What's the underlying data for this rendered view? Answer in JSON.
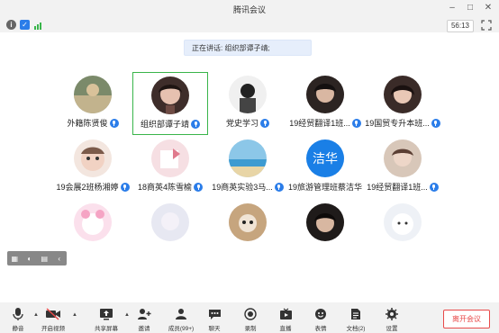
{
  "window": {
    "title": "腾讯会议"
  },
  "status": {
    "timer": "56:13"
  },
  "main": {
    "speaking": "正在讲话: 组织部谭子靖;"
  },
  "participants": [
    {
      "name": "外籍陈贤俊",
      "mic": true
    },
    {
      "name": "组织部谭子靖",
      "mic": true,
      "active": true
    },
    {
      "name": "党史学习",
      "mic": true
    },
    {
      "name": "19经贸翻译1班...",
      "mic": true
    },
    {
      "name": "19国贸专升本班...",
      "mic": true
    },
    {
      "name": "19会展2班杨湘婷",
      "mic": true
    },
    {
      "name": "18商英4陈雪榆",
      "mic": true
    },
    {
      "name": "19商英实验3马...",
      "mic": true
    },
    {
      "name": "19旅游管理班蔡洁华",
      "mic": false,
      "avatar_text": "洁华"
    },
    {
      "name": "19经贸翻译1班...",
      "mic": true
    },
    {
      "name": "",
      "mic": false
    },
    {
      "name": "",
      "mic": false
    },
    {
      "name": "",
      "mic": false
    },
    {
      "name": "",
      "mic": false
    },
    {
      "name": "",
      "mic": false
    }
  ],
  "toolbar": {
    "mute": "静音",
    "video": "开启视频",
    "share": "共享屏幕",
    "invite": "邀请",
    "members": "成员(99+)",
    "chat": "聊天",
    "record": "录制",
    "live": "直播",
    "reactions": "表情",
    "docs": "文档(2)",
    "settings": "设置",
    "leave": "离开会议"
  }
}
